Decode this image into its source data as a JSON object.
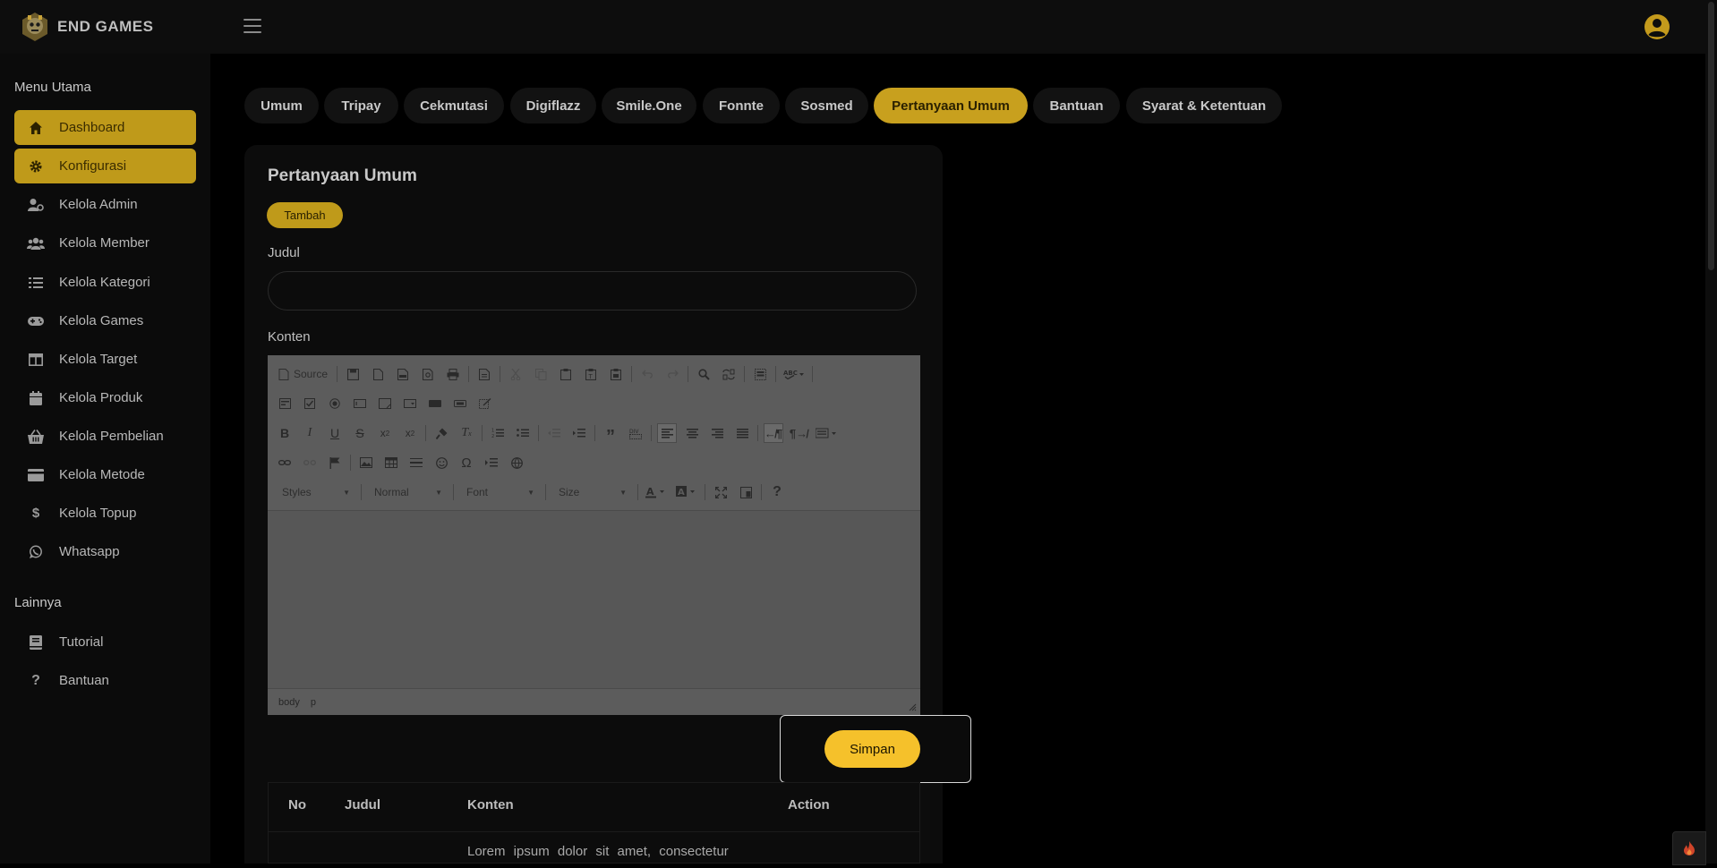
{
  "brand": {
    "name": "END GAMES"
  },
  "sidebar": {
    "sections": [
      "Menu Utama",
      "Lainnya"
    ],
    "items": [
      {
        "label": "Dashboard",
        "icon": "home-icon",
        "active": true
      },
      {
        "label": "Konfigurasi",
        "icon": "gear-icon",
        "active": true
      },
      {
        "label": "Kelola Admin",
        "icon": "user-cog-icon"
      },
      {
        "label": "Kelola Member",
        "icon": "users-icon"
      },
      {
        "label": "Kelola Kategori",
        "icon": "list-icon"
      },
      {
        "label": "Kelola Games",
        "icon": "gamepad-icon"
      },
      {
        "label": "Kelola Target",
        "icon": "table-icon"
      },
      {
        "label": "Kelola Produk",
        "icon": "calendar-icon"
      },
      {
        "label": "Kelola Pembelian",
        "icon": "basket-icon"
      },
      {
        "label": "Kelola Metode",
        "icon": "credit-card-icon"
      },
      {
        "label": "Kelola Topup",
        "icon": "dollar-icon"
      },
      {
        "label": "Whatsapp",
        "icon": "whatsapp-icon"
      }
    ],
    "other_items": [
      {
        "label": "Tutorial",
        "icon": "book-icon"
      },
      {
        "label": "Bantuan",
        "icon": "question-icon"
      }
    ]
  },
  "tabs": [
    {
      "label": "Umum"
    },
    {
      "label": "Tripay"
    },
    {
      "label": "Cekmutasi"
    },
    {
      "label": "Digiflazz"
    },
    {
      "label": "Smile.One"
    },
    {
      "label": "Fonnte"
    },
    {
      "label": "Sosmed"
    },
    {
      "label": "Pertanyaan Umum",
      "active": true
    },
    {
      "label": "Bantuan"
    },
    {
      "label": "Syarat & Ketentuan"
    }
  ],
  "form": {
    "title": "Pertanyaan Umum",
    "add_label": "Tambah",
    "judul_label": "Judul",
    "judul_value": "",
    "konten_label": "Konten",
    "save_label": "Simpan"
  },
  "editor": {
    "source_label": "Source",
    "combos": [
      "Styles",
      "Normal",
      "Font",
      "Size"
    ],
    "path": [
      "body",
      "p"
    ]
  },
  "table": {
    "columns": [
      "No",
      "Judul",
      "Konten",
      "Action"
    ],
    "rows": [
      {
        "konten": "Lorem ipsum dolor sit amet, consectetur"
      }
    ]
  },
  "colors": {
    "accent": "#bf9a1a",
    "save": "#f5c12b",
    "background": "#000000"
  }
}
